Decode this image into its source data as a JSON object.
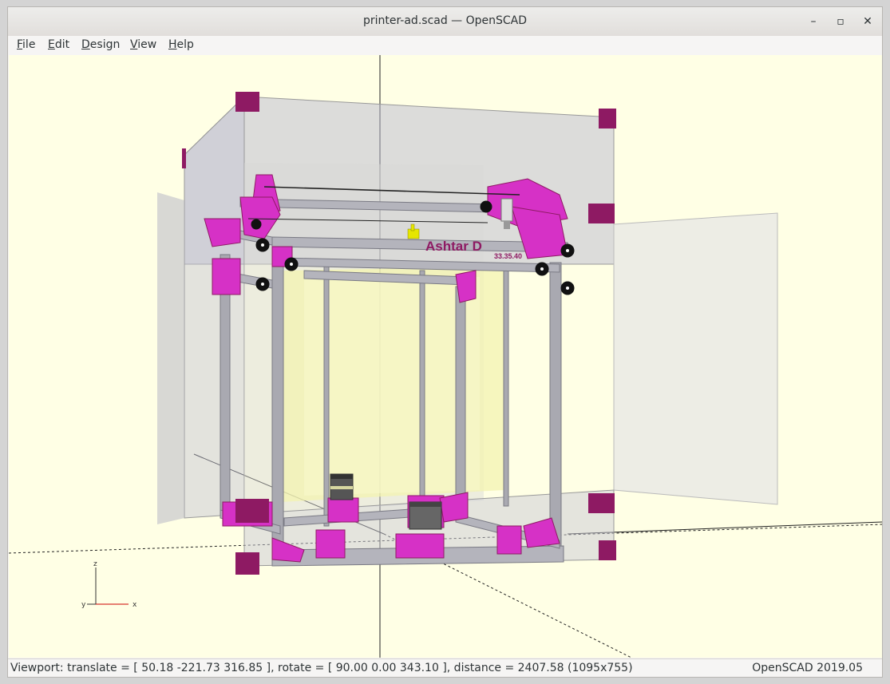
{
  "window": {
    "title": "printer-ad.scad — OpenSCAD",
    "controls": {
      "minimize": "–",
      "maximize": "▫",
      "close": "✕"
    }
  },
  "menu": {
    "items": [
      {
        "label": "File"
      },
      {
        "label": "Edit"
      },
      {
        "label": "Design"
      },
      {
        "label": "View"
      },
      {
        "label": "Help"
      }
    ]
  },
  "viewport": {
    "background": "#ffffe5",
    "model_label": "Ashtar D",
    "model_sublabel": "33.35.40",
    "axes": {
      "z": "z",
      "x": "x",
      "y": "y"
    },
    "colors": {
      "magenta": "#d631c6",
      "dark_magenta": "#8e1a63",
      "frame": "#a9a9b1",
      "bed": "#f3f3b0"
    }
  },
  "status": {
    "viewport_text": "Viewport: translate = [ 50.18 -221.73 316.85 ], rotate = [ 90.00 0.00 343.10 ], distance = 2407.58 (1095x755)",
    "version": "OpenSCAD 2019.05"
  }
}
